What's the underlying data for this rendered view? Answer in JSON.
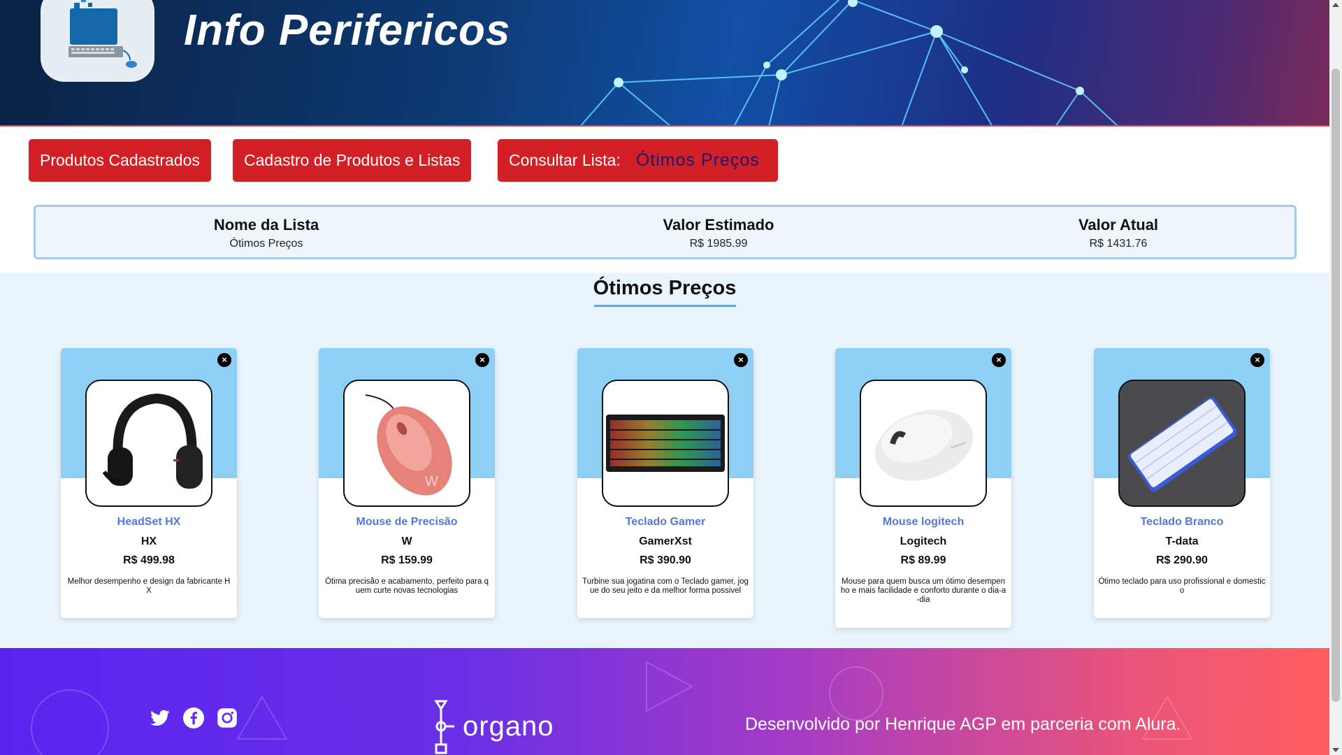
{
  "header": {
    "title": "Info Perifericos",
    "banner_colors": [
      "#0a2244",
      "#1150a6",
      "#7a2a5a"
    ]
  },
  "nav": {
    "products_label": "Produtos Cadastrados",
    "register_label": "Cadastro de Produtos e Listas",
    "consult_label": "Consultar Lista:",
    "consult_selected": "Ótimos Preços",
    "button_color": "#d32026"
  },
  "summary": {
    "name_header": "Nome da Lista",
    "name_value": "Ótimos Preços",
    "estimated_header": "Valor Estimado",
    "estimated_value": "R$ 1985.99",
    "current_header": "Valor Atual",
    "current_value": "R$ 1431.76"
  },
  "list": {
    "title": "Ótimos Preços"
  },
  "products": [
    {
      "name": "HeadSet HX",
      "brand": "HX",
      "price": "R$ 499.98",
      "description": "Melhor desempenho e design da fabricante HX",
      "icon": "headset-icon",
      "close": "×"
    },
    {
      "name": "Mouse de Precisão",
      "brand": "W",
      "price": "R$ 159.99",
      "description": "Ótima precisão e acabamento, perfeito para quem curte novas tecnologias",
      "icon": "mouse-icon",
      "close": "×"
    },
    {
      "name": "Teclado Gamer",
      "brand": "GamerXst",
      "price": "R$ 390.90",
      "description": "Turbine sua jogatina com o Teclado gamer, jogue do seu jeito e da melhor forma possivel",
      "icon": "keyboard-icon",
      "close": "×"
    },
    {
      "name": "Mouse logitech",
      "brand": "Logitech",
      "price": "R$ 89.99",
      "description": "Mouse para quem busca um ótimo desempenho e mais facilidade e conforto durante o dia-a-dia",
      "icon": "mouse-icon",
      "close": "×"
    },
    {
      "name": "Teclado Branco",
      "brand": "T-data",
      "price": "R$ 290.90",
      "description": "Ótimo teclado para uso profissional e domestico",
      "icon": "keyboard-icon",
      "close": "×"
    }
  ],
  "footer": {
    "brand": "organo",
    "credits": "Desenvolvido por Henrique AGP em parceria com Alura.",
    "social_icons": [
      "twitter-icon",
      "facebook-icon",
      "instagram-icon"
    ]
  }
}
